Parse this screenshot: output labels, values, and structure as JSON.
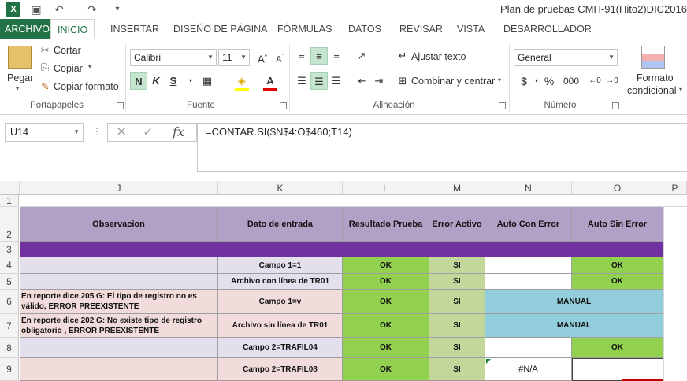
{
  "window": {
    "title": "Plan de pruebas CMH-91(Hito2)DIC2016"
  },
  "quick_access": {
    "app_icon": "X"
  },
  "tabs": [
    "ARCHIVO",
    "INICIO",
    "INSERTAR",
    "DISEÑO DE PÁGINA",
    "FÓRMULAS",
    "DATOS",
    "REVISAR",
    "VISTA",
    "DESARROLLADOR"
  ],
  "ribbon": {
    "clipboard": {
      "paste": "Pegar",
      "cut": "Cortar",
      "copy": "Copiar",
      "format_painter": "Copiar formato",
      "label": "Portapapeles"
    },
    "font": {
      "name": "Calibri",
      "size": "11",
      "bold": "N",
      "italic": "K",
      "underline": "S",
      "label": "Fuente"
    },
    "alignment": {
      "wrap": "Ajustar texto",
      "merge": "Combinar y centrar",
      "label": "Alineación"
    },
    "number": {
      "format": "General",
      "currency": "$",
      "percent": "%",
      "thousands": "000",
      "label": "Número"
    },
    "styles": {
      "conditional_line1": "Formato",
      "conditional_line2": "condicional"
    }
  },
  "formula_bar": {
    "name_box": "U14",
    "formula": "=CONTAR.SI($N$4:O$460;T14)"
  },
  "sheet": {
    "columns": [
      "J",
      "K",
      "L",
      "M",
      "N",
      "O",
      "P"
    ],
    "rows": [
      "1",
      "2",
      "3",
      "4",
      "5",
      "6",
      "7",
      "8",
      "9"
    ],
    "headers": {
      "j": "Observacion",
      "k": "Dato de entrada",
      "l": "Resultado Prueba",
      "m": "Error Activo",
      "n": "Auto Con Error",
      "o": "Auto Sin Error"
    },
    "data": [
      {
        "j": "",
        "k": "Campo 1=1",
        "l": "OK",
        "m": "SI",
        "n": "",
        "o": "OK"
      },
      {
        "j": "",
        "k": "Archivo con línea de TR01",
        "l": "OK",
        "m": "SI",
        "n": "",
        "o": "OK"
      },
      {
        "j": "En reporte dice 205 G: El tipo de registro no es válido, ERROR PREEXISTENTE",
        "k": "Campo 1=v",
        "l": "OK",
        "m": "SI",
        "manual": "MANUAL"
      },
      {
        "j": "En reporte dice 202 G: No existe tipo de registro obligatorio , ERROR PREEXISTENTE",
        "k": "Archivo sin línea de TR01",
        "l": "OK",
        "m": "SI",
        "manual": "MANUAL"
      },
      {
        "j": "",
        "k": "Campo 2=TRAFIL04",
        "l": "OK",
        "m": "SI",
        "n": "",
        "o": "OK"
      },
      {
        "j": "",
        "k": "Campo 2=TRAFIL08",
        "l": "OK",
        "m": "SI",
        "n": "#N/A",
        "o": ""
      }
    ]
  },
  "colors": {
    "accent": "#217346",
    "header_purple": "#b2a1c7",
    "band_purple": "#7030a0",
    "ok_green": "#92d050",
    "si_green": "#c4d79b",
    "manual_blue": "#92cddc",
    "lavender": "#e4dfec",
    "pink": "#f2dcdb"
  }
}
